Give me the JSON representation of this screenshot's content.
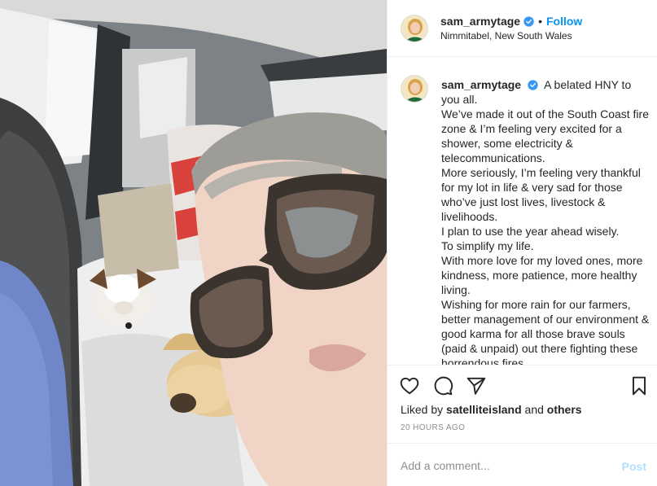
{
  "post": {
    "username": "sam_armytage",
    "follow_label": "Follow",
    "separator": "•",
    "location": "Nimmitabel, New South Wales"
  },
  "caption": {
    "username": "sam_armytage",
    "lines": [
      "A belated HNY to you all.",
      "We’ve made it out of the South Coast fire zone & I’m feeling very excited for a shower, some electricity & telecommunications.",
      "More seriously, I’m feeling very thankful for my lot in life & very sad for those who’ve just lost lives, livestock & livelihoods.",
      "I plan to use the year ahead wisely.",
      "To simplify my life.",
      "With more love for my loved ones, more kindness, more patience, more healthy living.",
      "Wishing for more rain for our farmers, better management of our environment & good karma for all those brave souls (paid & unpaid) out there fighting these horrendous fires."
    ]
  },
  "likes": {
    "prefix": "Liked by",
    "user": "satelliteisland",
    "conjunction": "and",
    "suffix": "others"
  },
  "timestamp": "20 HOURS AGO",
  "comment_box": {
    "placeholder": "Add a comment...",
    "post_label": "Post"
  },
  "icons": {
    "verified": "verified-badge-icon",
    "like": "heart-icon",
    "comment": "comment-icon",
    "share": "paper-plane-icon",
    "save": "bookmark-icon"
  },
  "colors": {
    "accent": "#0095f6",
    "post_disabled": "#b2dffc",
    "muted": "#8e8e8e",
    "text": "#262626",
    "border": "#efefef"
  }
}
